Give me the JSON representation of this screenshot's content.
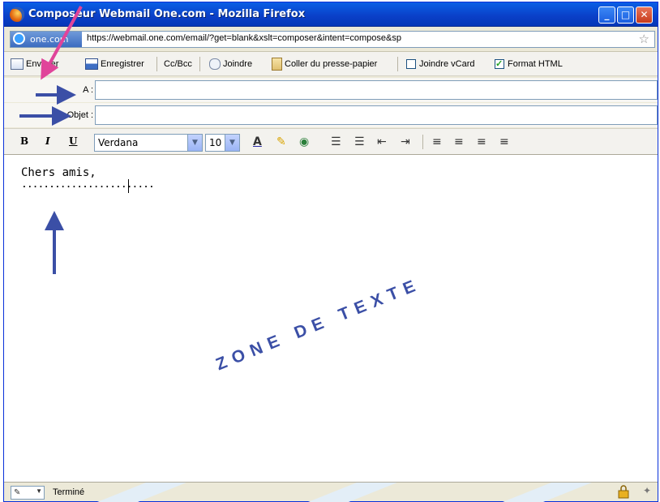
{
  "window": {
    "title": "Composeur Webmail One.com - Mozilla Firefox",
    "controls": {
      "minimize": "_",
      "maximize": "□",
      "close": "✕"
    }
  },
  "urlbar": {
    "site": "one.com",
    "url": "https://webmail.one.com/email/?get=blank&xslt=composer&intent=compose&sp"
  },
  "toolbar": {
    "send_label": "Envoyer",
    "save_label": "Enregistrer",
    "ccbcc_label": "Cc/Bcc",
    "attach_label": "Joindre",
    "paste_label": "Coller du presse-papier",
    "vcard_label": "Joindre vCard",
    "vcard_checked": false,
    "html_label": "Format HTML",
    "html_checked": true
  },
  "fields": {
    "to_label": "A :",
    "subject_label": "Objet :",
    "to_value": "",
    "subject_value": ""
  },
  "format": {
    "bold": "B",
    "italic": "I",
    "underline": "U",
    "font": "Verdana",
    "size": "10"
  },
  "editor": {
    "line1": "Chers amis,",
    "line2": "........................",
    "annotation": "ZONE DE TEXTE"
  },
  "status": {
    "text": "Terminé"
  },
  "colors": {
    "arrow_blue": "#3b4fa6",
    "arrow_pink": "#e0449a",
    "titlebar": "#0a5fe5"
  }
}
